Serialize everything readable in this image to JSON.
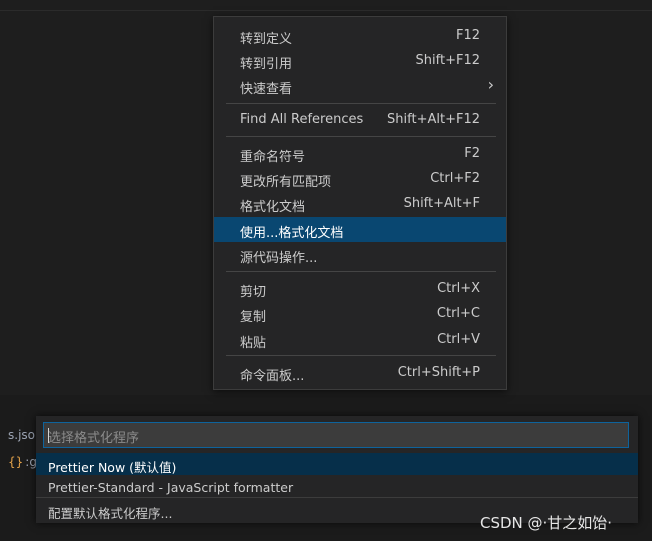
{
  "context_menu": {
    "items": [
      {
        "label": "转到定义",
        "shortcut": "F12"
      },
      {
        "label": "转到引用",
        "shortcut": "Shift+F12"
      },
      {
        "label": "快速查看",
        "submenu_icon": "chevron-right-icon"
      },
      {
        "label": "Find All References",
        "shortcut": "Shift+Alt+F12"
      },
      {
        "label": "重命名符号",
        "shortcut": "F2"
      },
      {
        "label": "更改所有匹配项",
        "shortcut": "Ctrl+F2"
      },
      {
        "label": "格式化文档",
        "shortcut": "Shift+Alt+F"
      },
      {
        "label": "使用...格式化文档",
        "active": true
      },
      {
        "label": "源代码操作..."
      },
      {
        "label": "剪切",
        "shortcut": "Ctrl+X"
      },
      {
        "label": "复制",
        "shortcut": "Ctrl+C"
      },
      {
        "label": "粘贴",
        "shortcut": "Ctrl+V"
      },
      {
        "label": "命令面板...",
        "shortcut": "Ctrl+Shift+P"
      }
    ]
  },
  "quick_pick": {
    "placeholder": "选择格式化程序",
    "items": [
      {
        "label": "Prettier Now (默认值)",
        "active": true
      },
      {
        "label": "Prettier-Standard - JavaScript formatter"
      },
      {
        "label": "配置默认格式化程序..."
      }
    ]
  },
  "editor": {
    "tab_fragment_1": "s.jso",
    "tab_fragment_2": ":gl"
  },
  "watermark": "CSDN @·甘之如饴·",
  "colors": {
    "menu_bg": "#252526",
    "active_item": "#094771",
    "focus_border": "#0e639c",
    "json_icon": "#e5a34a"
  }
}
